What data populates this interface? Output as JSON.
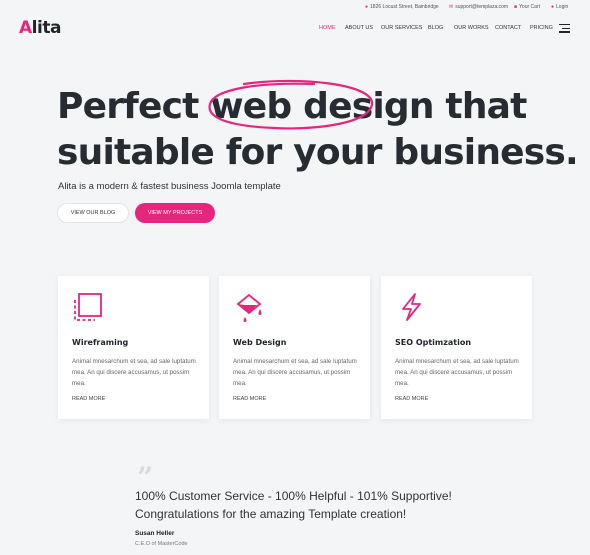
{
  "topbar": {
    "address": "1826 Locust Street, Bainbridge",
    "email": "support@templaza.com",
    "cart": "Your Cart",
    "login": "Login"
  },
  "logo": {
    "first": "A",
    "rest": "lita"
  },
  "nav": {
    "items": [
      {
        "label": "HOME",
        "active": true
      },
      {
        "label": "ABOUT US"
      },
      {
        "label": "OUR SERVICES"
      },
      {
        "label": "BLOG"
      },
      {
        "label": "OUR WORKS"
      },
      {
        "label": "CONTACT"
      },
      {
        "label": "PRICING"
      }
    ]
  },
  "hero": {
    "title_pre": "Perfect ",
    "title_highlight": "web design",
    "title_post": " that",
    "title_line2": "suitable for your business.",
    "subtitle": "Alita is a modern & fastest business Joomla template",
    "btn_blog": "VIEW OUR BLOG",
    "btn_projects": "VIEW MY PROJECTS"
  },
  "services": [
    {
      "icon": "wireframe-icon",
      "title": "Wireframing",
      "body": "Animal mnesarchum et sea, ad sale luptatum mea. An qui discere accusamus, ut possim mea.",
      "more": "READ MORE"
    },
    {
      "icon": "paint-bucket-icon",
      "title": "Web Design",
      "body": "Animal mnesarchum et sea, ad sale luptatum mea. An qui discere accusamus, ut possim mea.",
      "more": "READ MORE"
    },
    {
      "icon": "lightning-icon",
      "title": "SEO Optimzation",
      "body": "Animal mnesarchum et sea, ad sale luptatum mea. An qui discere accusamus, ut possim mea.",
      "more": "READ MORE"
    }
  ],
  "testimonial": {
    "line1": "100% Customer Service - 100% Helpful - 101% Supportive!",
    "line2": "Congratulations for the amazing Template creation!",
    "author": "Susan Heller",
    "role": "C.E.O of MasterCode"
  },
  "colors": {
    "accent": "#e6257c",
    "heading": "#262c31",
    "background": "#f4f5f7"
  }
}
